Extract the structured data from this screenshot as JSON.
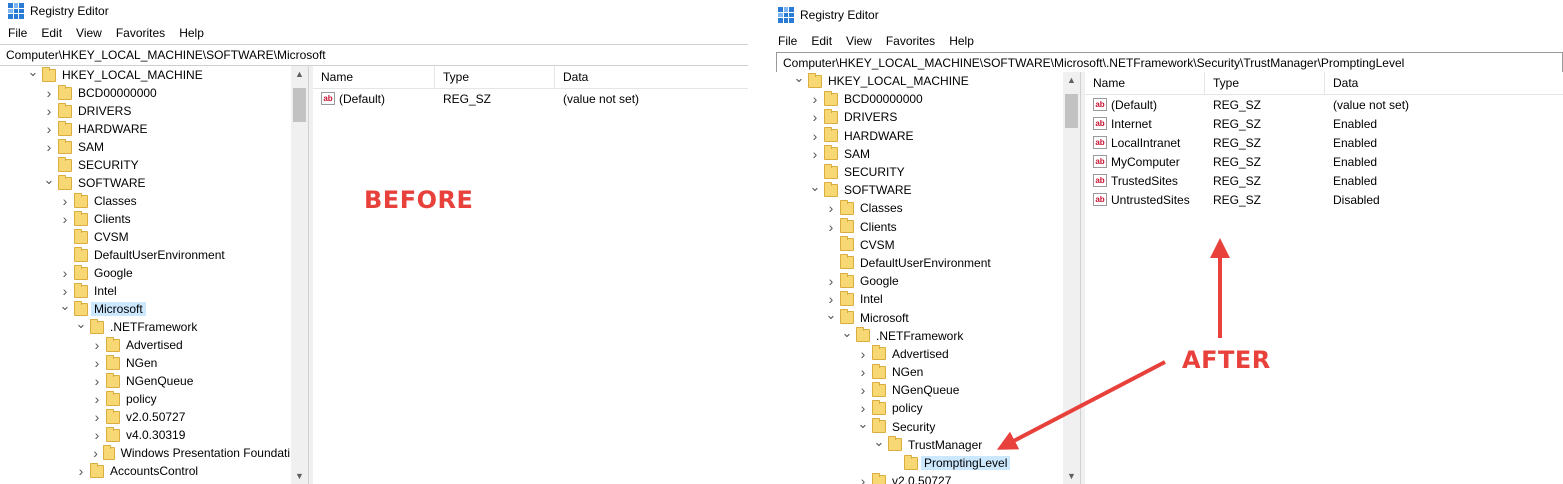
{
  "before_window": {
    "title": "Registry Editor",
    "menu": [
      "File",
      "Edit",
      "View",
      "Favorites",
      "Help"
    ],
    "address": "Computer\\HKEY_LOCAL_MACHINE\\SOFTWARE\\Microsoft",
    "tree": [
      {
        "label": "HKEY_LOCAL_MACHINE",
        "level": 0,
        "expanded": true
      },
      {
        "label": "BCD00000000",
        "level": 1,
        "expanded": false
      },
      {
        "label": "DRIVERS",
        "level": 1,
        "expanded": false
      },
      {
        "label": "HARDWARE",
        "level": 1,
        "expanded": false
      },
      {
        "label": "SAM",
        "level": 1,
        "expanded": false
      },
      {
        "label": "SECURITY",
        "level": 1,
        "expanded": null
      },
      {
        "label": "SOFTWARE",
        "level": 1,
        "expanded": true
      },
      {
        "label": "Classes",
        "level": 2,
        "expanded": false
      },
      {
        "label": "Clients",
        "level": 2,
        "expanded": false
      },
      {
        "label": "CVSM",
        "level": 2,
        "expanded": null
      },
      {
        "label": "DefaultUserEnvironment",
        "level": 2,
        "expanded": null
      },
      {
        "label": "Google",
        "level": 2,
        "expanded": false
      },
      {
        "label": "Intel",
        "level": 2,
        "expanded": false
      },
      {
        "label": "Microsoft",
        "level": 2,
        "expanded": true,
        "selected": true
      },
      {
        "label": ".NETFramework",
        "level": 3,
        "expanded": true
      },
      {
        "label": "Advertised",
        "level": 4,
        "expanded": false
      },
      {
        "label": "NGen",
        "level": 4,
        "expanded": false
      },
      {
        "label": "NGenQueue",
        "level": 4,
        "expanded": false
      },
      {
        "label": "policy",
        "level": 4,
        "expanded": false
      },
      {
        "label": "v2.0.50727",
        "level": 4,
        "expanded": false
      },
      {
        "label": "v4.0.30319",
        "level": 4,
        "expanded": false
      },
      {
        "label": "Windows Presentation Foundati",
        "level": 4,
        "expanded": false
      },
      {
        "label": "AccountsControl",
        "level": 3,
        "expanded": false
      }
    ],
    "columns": {
      "name": "Name",
      "type": "Type",
      "data": "Data"
    },
    "values": [
      {
        "name": "(Default)",
        "type": "REG_SZ",
        "data": "(value not set)"
      }
    ]
  },
  "after_window": {
    "title": "Registry Editor",
    "menu": [
      "File",
      "Edit",
      "View",
      "Favorites",
      "Help"
    ],
    "address": "Computer\\HKEY_LOCAL_MACHINE\\SOFTWARE\\Microsoft\\.NETFramework\\Security\\TrustManager\\PromptingLevel",
    "tree": [
      {
        "label": "HKEY_LOCAL_MACHINE",
        "level": 0,
        "expanded": true
      },
      {
        "label": "BCD00000000",
        "level": 1,
        "expanded": false
      },
      {
        "label": "DRIVERS",
        "level": 1,
        "expanded": false
      },
      {
        "label": "HARDWARE",
        "level": 1,
        "expanded": false
      },
      {
        "label": "SAM",
        "level": 1,
        "expanded": false
      },
      {
        "label": "SECURITY",
        "level": 1,
        "expanded": null
      },
      {
        "label": "SOFTWARE",
        "level": 1,
        "expanded": true
      },
      {
        "label": "Classes",
        "level": 2,
        "expanded": false
      },
      {
        "label": "Clients",
        "level": 2,
        "expanded": false
      },
      {
        "label": "CVSM",
        "level": 2,
        "expanded": null
      },
      {
        "label": "DefaultUserEnvironment",
        "level": 2,
        "expanded": null
      },
      {
        "label": "Google",
        "level": 2,
        "expanded": false
      },
      {
        "label": "Intel",
        "level": 2,
        "expanded": false
      },
      {
        "label": "Microsoft",
        "level": 2,
        "expanded": true
      },
      {
        "label": ".NETFramework",
        "level": 3,
        "expanded": true
      },
      {
        "label": "Advertised",
        "level": 4,
        "expanded": false
      },
      {
        "label": "NGen",
        "level": 4,
        "expanded": false
      },
      {
        "label": "NGenQueue",
        "level": 4,
        "expanded": false
      },
      {
        "label": "policy",
        "level": 4,
        "expanded": false
      },
      {
        "label": "Security",
        "level": 4,
        "expanded": true
      },
      {
        "label": "TrustManager",
        "level": 5,
        "expanded": true
      },
      {
        "label": "PromptingLevel",
        "level": 6,
        "expanded": null,
        "selected": true
      },
      {
        "label": "v2.0.50727",
        "level": 4,
        "expanded": false
      }
    ],
    "columns": {
      "name": "Name",
      "type": "Type",
      "data": "Data"
    },
    "values": [
      {
        "name": "(Default)",
        "type": "REG_SZ",
        "data": "(value not set)"
      },
      {
        "name": "Internet",
        "type": "REG_SZ",
        "data": "Enabled"
      },
      {
        "name": "LocalIntranet",
        "type": "REG_SZ",
        "data": "Enabled"
      },
      {
        "name": "MyComputer",
        "type": "REG_SZ",
        "data": "Enabled"
      },
      {
        "name": "TrustedSites",
        "type": "REG_SZ",
        "data": "Enabled"
      },
      {
        "name": "UntrustedSites",
        "type": "REG_SZ",
        "data": "Disabled"
      }
    ]
  },
  "annotations": {
    "before_label": "BEFORE",
    "after_label": "AFTER",
    "color": "#e8413c"
  },
  "icons": {
    "app": "registry-editor-icon",
    "folder": "folder-icon",
    "value": "string-value-icon",
    "value_glyph": "ab"
  }
}
